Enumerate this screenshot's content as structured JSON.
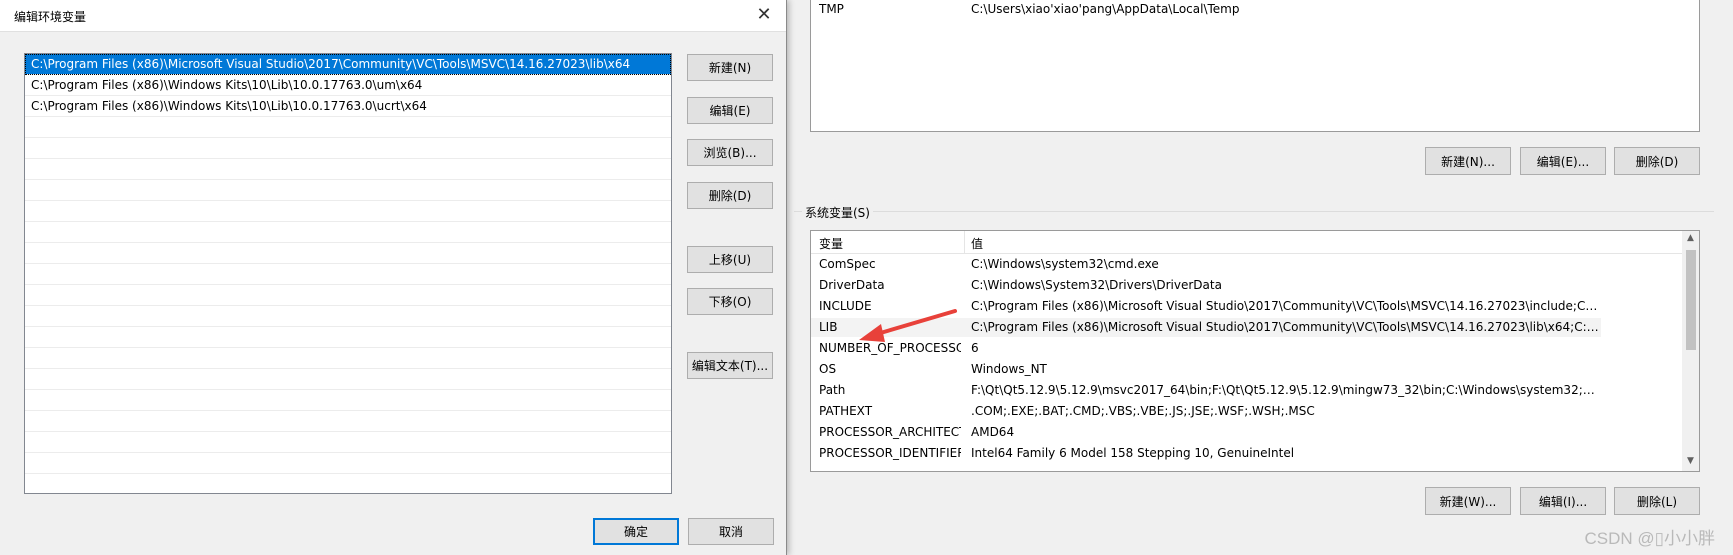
{
  "edit_dialog": {
    "title": "编辑环境变量",
    "close_glyph": "✕",
    "paths": [
      "C:\\Program Files (x86)\\Microsoft Visual Studio\\2017\\Community\\VC\\Tools\\MSVC\\14.16.27023\\lib\\x64",
      "C:\\Program Files (x86)\\Windows Kits\\10\\Lib\\10.0.17763.0\\um\\x64",
      "C:\\Program Files (x86)\\Windows Kits\\10\\Lib\\10.0.17763.0\\ucrt\\x64"
    ],
    "buttons": {
      "new": "新建(N)",
      "edit": "编辑(E)",
      "browse": "浏览(B)...",
      "delete": "删除(D)",
      "move_up": "上移(U)",
      "move_down": "下移(O)",
      "edit_text": "编辑文本(T)..."
    },
    "ok": "确定",
    "cancel": "取消"
  },
  "user_vars": {
    "rows": [
      {
        "name": "TMP",
        "value": "C:\\Users\\xiao'xiao'pang\\AppData\\Local\\Temp"
      }
    ],
    "buttons": {
      "new": "新建(N)...",
      "edit": "编辑(E)...",
      "delete": "删除(D)"
    }
  },
  "system_vars": {
    "group_label": "系统变量(S)",
    "col_name": "变量",
    "col_value": "值",
    "rows": [
      {
        "name": "ComSpec",
        "value": "C:\\Windows\\system32\\cmd.exe"
      },
      {
        "name": "DriverData",
        "value": "C:\\Windows\\System32\\Drivers\\DriverData"
      },
      {
        "name": "INCLUDE",
        "value": "C:\\Program Files (x86)\\Microsoft Visual Studio\\2017\\Community\\VC\\Tools\\MSVC\\14.16.27023\\include;C:\\Program Fil..."
      },
      {
        "name": "LIB",
        "value": "C:\\Program Files (x86)\\Microsoft Visual Studio\\2017\\Community\\VC\\Tools\\MSVC\\14.16.27023\\lib\\x64;C:\\Program File..."
      },
      {
        "name": "NUMBER_OF_PROCESSORS",
        "value": "6"
      },
      {
        "name": "OS",
        "value": "Windows_NT"
      },
      {
        "name": "Path",
        "value": "F:\\Qt\\Qt5.12.9\\5.12.9\\msvc2017_64\\bin;F:\\Qt\\Qt5.12.9\\5.12.9\\mingw73_32\\bin;C:\\Windows\\system32;C:\\Windows;C:\\W..."
      },
      {
        "name": "PATHEXT",
        "value": ".COM;.EXE;.BAT;.CMD;.VBS;.VBE;.JS;.JSE;.WSF;.WSH;.MSC"
      },
      {
        "name": "PROCESSOR_ARCHITECT...",
        "value": "AMD64"
      },
      {
        "name": "PROCESSOR_IDENTIFIER",
        "value": "Intel64 Family 6 Model 158 Stepping 10, GenuineIntel"
      }
    ],
    "buttons": {
      "new": "新建(W)...",
      "edit": "编辑(I)...",
      "delete": "删除(L)"
    }
  },
  "watermark": "CSDN @▯小小胖",
  "colors": {
    "selection": "#0078d7",
    "arrow": "#e8413a"
  }
}
